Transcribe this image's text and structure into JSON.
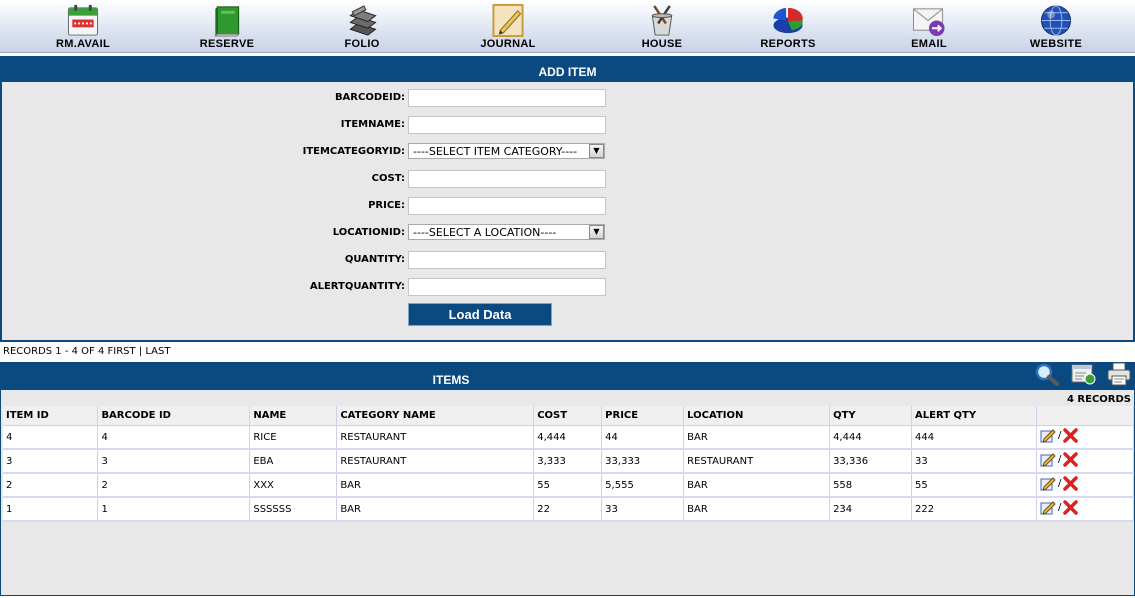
{
  "toolbar": {
    "items": [
      {
        "label": "RM.AVAIL",
        "icon": "calendar-icon"
      },
      {
        "label": "RESERVE",
        "icon": "book-icon"
      },
      {
        "label": "FOLIO",
        "icon": "stack-icon"
      },
      {
        "label": "JOURNAL",
        "icon": "notepad-icon"
      },
      {
        "label": "HOUSE",
        "icon": "cleaning-bucket-icon"
      },
      {
        "label": "REPORTS",
        "icon": "pie-chart-icon"
      },
      {
        "label": "EMAIL",
        "icon": "envelope-icon"
      },
      {
        "label": "WEBSITE",
        "icon": "globe-icon"
      }
    ]
  },
  "add_item": {
    "title": "ADD ITEM",
    "fields": {
      "barcodeid": {
        "label": "BARCODEID:",
        "value": ""
      },
      "itemname": {
        "label": "ITEMNAME:",
        "value": ""
      },
      "itemcategoryid": {
        "label": "ITEMCATEGORYID:",
        "value": "----SELECT ITEM CATEGORY----"
      },
      "cost": {
        "label": "COST:",
        "value": ""
      },
      "price": {
        "label": "PRICE:",
        "value": ""
      },
      "locationid": {
        "label": "LOCATIONID:",
        "value": "----SELECT A LOCATION----"
      },
      "quantity": {
        "label": "QUANTITY:",
        "value": ""
      },
      "alertquantity": {
        "label": "ALERTQUANTITY:",
        "value": ""
      }
    },
    "button_label": "Load Data"
  },
  "records": {
    "text": "RECORDS 1 - 4 OF 4",
    "first": "FIRST",
    "separator": "|",
    "last": "LAST"
  },
  "items": {
    "title": "ITEMS",
    "count": "4 RECORDS",
    "icons": [
      "search-icon",
      "export-icon",
      "print-icon"
    ],
    "columns": [
      "ITEM ID",
      "BARCODE ID",
      "NAME",
      "CATEGORY NAME",
      "COST",
      "PRICE",
      "LOCATION",
      "QTY",
      "ALERT QTY"
    ],
    "rows": [
      [
        "4",
        "4",
        "RICE",
        "RESTAURANT",
        "4,444",
        "44",
        "BAR",
        "4,444",
        "444"
      ],
      [
        "3",
        "3",
        "EBA",
        "RESTAURANT",
        "3,333",
        "33,333",
        "RESTAURANT",
        "33,336",
        "33"
      ],
      [
        "2",
        "2",
        "XXX",
        "BAR",
        "55",
        "5,555",
        "BAR",
        "558",
        "55"
      ],
      [
        "1",
        "1",
        "SSSSSS",
        "BAR",
        "22",
        "33",
        "BAR",
        "234",
        "222"
      ]
    ],
    "action_separator": "/"
  },
  "colors": {
    "header_blue": "#0b4a80",
    "panel_bg": "#e8e8e8",
    "delete_red": "#e02020"
  }
}
